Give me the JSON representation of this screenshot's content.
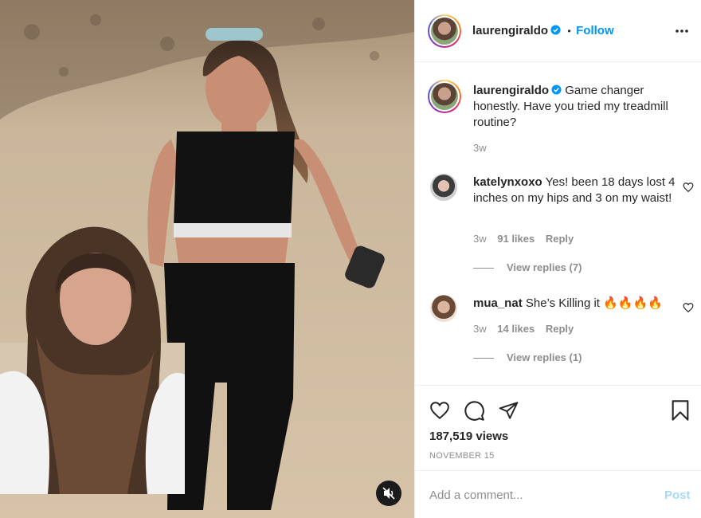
{
  "header": {
    "username": "laurengiraldo",
    "separator": "•",
    "follow_label": "Follow",
    "more_icon": "more-options-icon"
  },
  "caption": {
    "username": "laurengiraldo",
    "text": "Game changer honestly. Have you tried my treadmill routine?",
    "time": "3w"
  },
  "comments": [
    {
      "username": "katelynxoxo",
      "text": "Yes! been 18 days lost 4 inches on my hips and 3 on my waist!",
      "time": "3w",
      "likes": "91 likes",
      "reply_label": "Reply",
      "view_replies": "View replies (7)"
    },
    {
      "username": "mua_nat",
      "text": "She’s Killing it 🔥🔥🔥🔥",
      "time": "3w",
      "likes": "14 likes",
      "reply_label": "Reply",
      "view_replies": "View replies (1)"
    }
  ],
  "stats": {
    "views": "187,519 views",
    "date": "NOVEMBER 15"
  },
  "composer": {
    "placeholder": "Add a comment...",
    "post_label": "Post"
  },
  "colors": {
    "accent": "#0095f6",
    "muted": "#8e8e8e",
    "text": "#262626"
  }
}
